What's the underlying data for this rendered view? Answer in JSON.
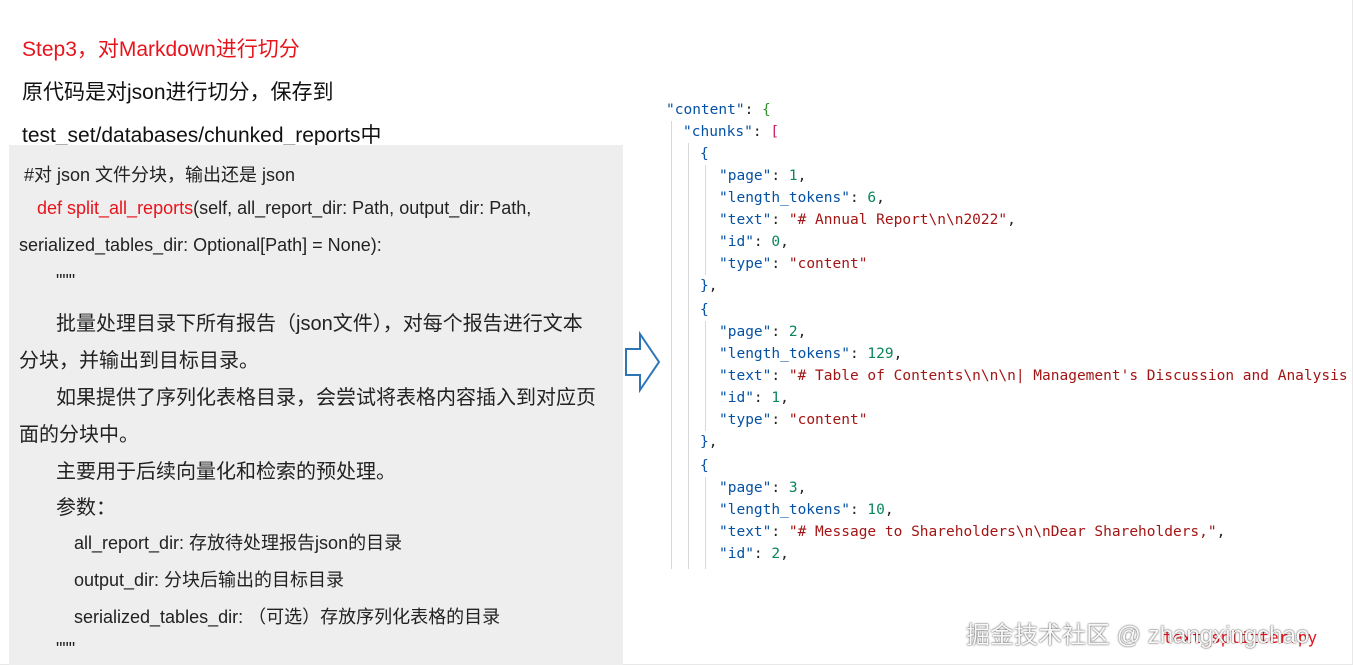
{
  "heading": "Step3，对Markdown进行切分",
  "intro": [
    "原代码是对json进行切分，保存到",
    "test_set/databases/chunked_reports中"
  ],
  "code": {
    "comment": "#对 json 文件分块，输出还是 json",
    "def_keyword": "def split_all_reports",
    "def_rest": "(self, all_report_dir: Path, output_dir: Path,",
    "def_cont": "serialized_tables_dir: Optional[Path] = None):",
    "doc_open": "\"\"\"",
    "doc_1a": "批量处理目录下所有报告（json文件），对每个报告进行文本",
    "doc_1b": "分块，并输出到目标目录。",
    "doc_2a": "如果提供了序列化表格目录，会尝试将表格内容插入到对应页",
    "doc_2b": "面的分块中。",
    "doc_3": "主要用于后续向量化和检索的预处理。",
    "params_label": "参数：",
    "param_1": "all_report_dir: 存放待处理报告json的目录",
    "param_2": "output_dir: 分块后输出的目标目录",
    "param_3": "serialized_tables_dir: （可选）存放序列化表格的目录",
    "doc_close": "\"\"\""
  },
  "json_view": {
    "content_key": "\"content\"",
    "chunks_key": "\"chunks\"",
    "chunks": [
      {
        "page": "1",
        "length_tokens": "6",
        "text": "\"# Annual Report\\n\\n2022\"",
        "id": "0",
        "type": "\"content\""
      },
      {
        "page": "2",
        "length_tokens": "129",
        "text": "\"# Table of Contents\\n\\n\\n| Management's Discussion and Analysis",
        "id": "1",
        "type": "\"content\""
      },
      {
        "page": "3",
        "length_tokens": "10",
        "text": "\"# Message to Shareholders\\n\\nDear Shareholders,\"",
        "id": "2"
      }
    ]
  },
  "filename": "text_splitter.py",
  "watermark": "掘金技术社区 @ zhangxingchao",
  "colors": {
    "accent_red": "#e8141c",
    "code_bg": "#eeeeee",
    "json_key": "#0451a5",
    "json_number": "#098658",
    "json_string": "#a31515",
    "arrow": "#2e75b6"
  }
}
